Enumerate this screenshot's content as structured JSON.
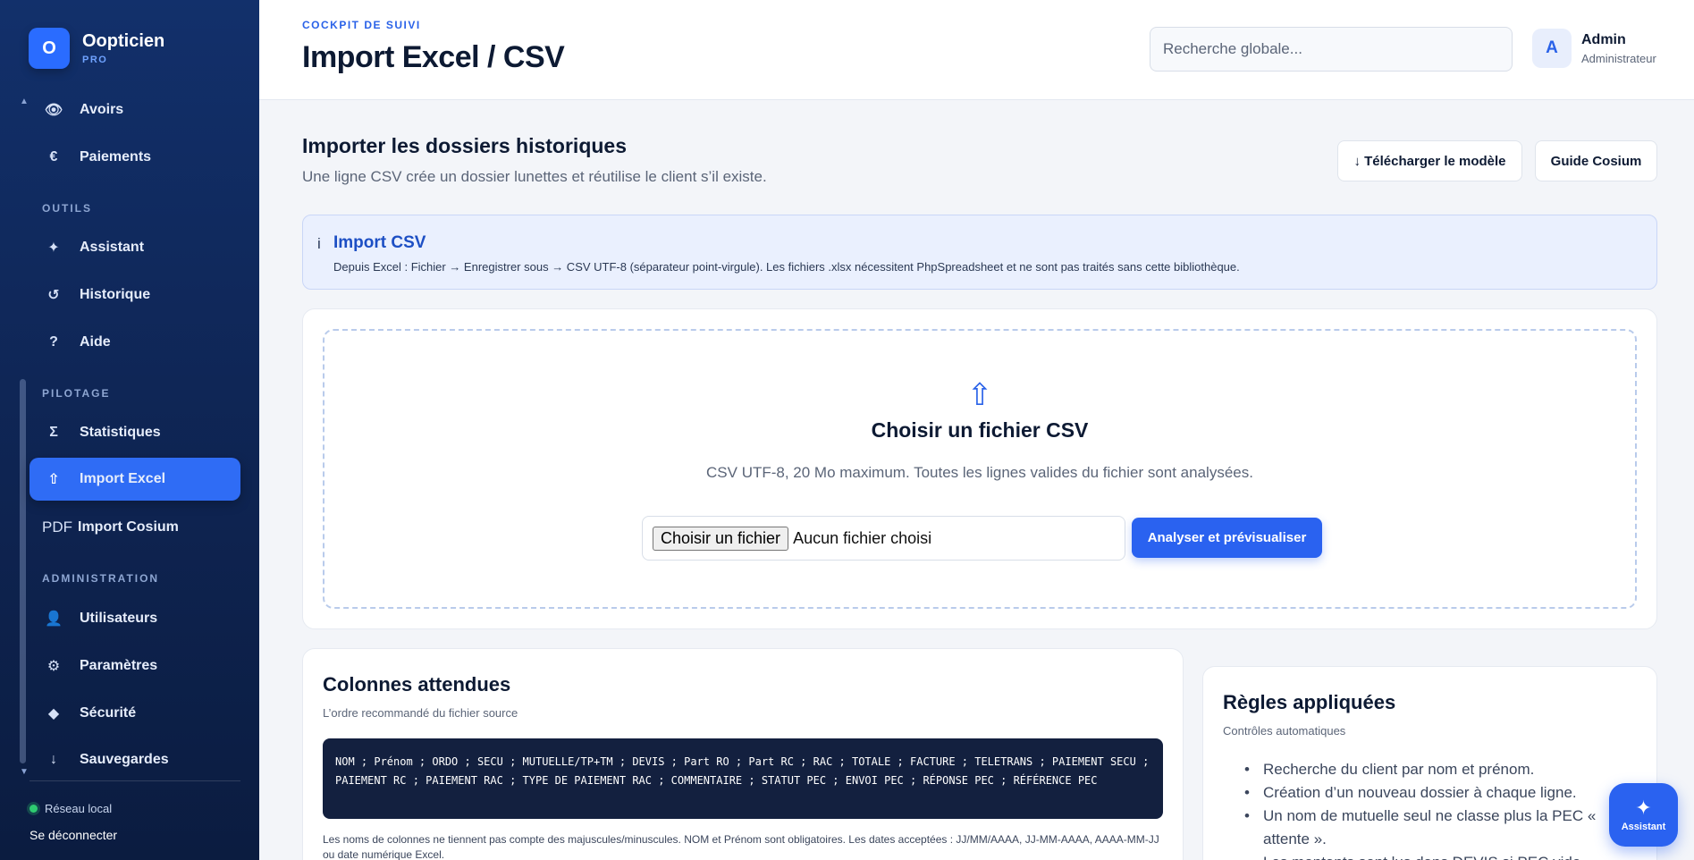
{
  "brand": {
    "logo_letter": "O",
    "name": "Oopticien",
    "sub": "PRO"
  },
  "sidebar": {
    "items_top": [
      {
        "icon": "👁",
        "label": "Avoirs"
      },
      {
        "icon": "€",
        "label": "Paiements"
      }
    ],
    "sections": [
      {
        "label": "OUTILS"
      },
      {
        "label": "PILOTAGE"
      },
      {
        "label": "ADMINISTRATION"
      }
    ],
    "outils": [
      {
        "icon": "✦",
        "label": "Assistant"
      },
      {
        "icon": "↺",
        "label": "Historique"
      },
      {
        "icon": "?",
        "label": "Aide"
      }
    ],
    "pilotage": [
      {
        "icon": "Σ",
        "label": "Statistiques"
      },
      {
        "icon": "⇧",
        "label": "Import Excel"
      },
      {
        "icon": "PDF",
        "label": "Import Cosium"
      }
    ],
    "administration": [
      {
        "icon": "👤",
        "label": "Utilisateurs"
      },
      {
        "icon": "⚙",
        "label": "Paramètres"
      },
      {
        "icon": "◆",
        "label": "Sécurité"
      },
      {
        "icon": "↓",
        "label": "Sauvegardes"
      }
    ],
    "network_label": "Réseau local",
    "logout_label": "Se déconnecter"
  },
  "header": {
    "kicker": "COCKPIT DE SUIVI",
    "title": "Import Excel / CSV",
    "search_placeholder": "Recherche globale...",
    "user": {
      "avatar_letter": "A",
      "name": "Admin",
      "role": "Administrateur"
    }
  },
  "main": {
    "section_title": "Importer les dossiers historiques",
    "section_sub": "Une ligne CSV crée un dossier lunettes et réutilise le client s’il existe.",
    "download_template_label": "↓ Télécharger le modèle",
    "guide_label": "Guide Cosium",
    "info": {
      "icon": "i",
      "title": "Import CSV",
      "text": "Depuis Excel : Fichier → Enregistrer sous → CSV UTF-8 (séparateur point-virgule). Les fichiers .xlsx nécessitent PhpSpreadsheet et ne sont pas traités sans cette bibliothèque."
    },
    "upload": {
      "icon": "⇧",
      "title": "Choisir un fichier CSV",
      "sub": "CSV UTF-8, 20 Mo maximum. Toutes les lignes valides du fichier sont analysées.",
      "file_button": "Choisir un fichier",
      "file_status": "Aucun fichier choisi",
      "analyze_label": "Analyser et prévisualiser"
    },
    "columns": {
      "title": "Colonnes attendues",
      "sub": "L’ordre recommandé du fichier source",
      "code": "NOM ; Prénom ; ORDO ; SECU ; MUTUELLE/TP+TM ; DEVIS ; Part RO ; Part RC ; RAC ; TOTALE ; FACTURE ; TELETRANS ; PAIEMENT SECU ; PAIEMENT RC ; PAIEMENT RAC ; TYPE DE PAIEMENT RAC ; COMMENTAIRE ; STATUT PEC ; ENVOI PEC ; RÉPONSE PEC ; RÉFÉRENCE PEC",
      "note": "Les noms de colonnes ne tiennent pas compte des majuscules/minuscules. NOM et Prénom sont obligatoires. Les dates acceptées : JJ/MM/AAAA, JJ-MM-AAAA, AAAA-MM-JJ ou date numérique Excel."
    },
    "rules": {
      "title": "Règles appliquées",
      "sub": "Contrôles automatiques",
      "items": [
        "Recherche du client par nom et prénom.",
        "Création d’un nouveau dossier à chaque ligne.",
        "Un nom de mutuelle seul ne classe plus la PEC « attente ».",
        "Les montants sont lus dans DEVIS si PEC vide."
      ]
    }
  },
  "fab": {
    "icon": "✦",
    "label": "Assistant"
  }
}
